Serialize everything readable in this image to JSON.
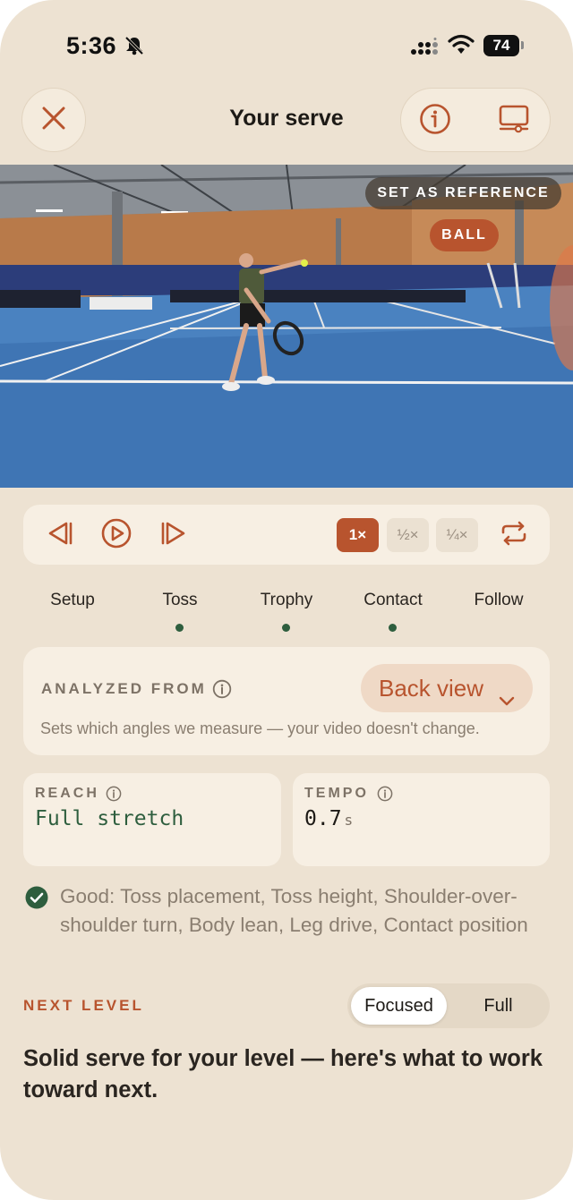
{
  "status_bar": {
    "time": "5:36",
    "battery": "74",
    "icons": [
      "bell-slash-icon",
      "signal-icon",
      "wifi-icon",
      "battery-icon"
    ]
  },
  "header": {
    "title": "Your serve",
    "close_icon": "close-icon",
    "info_icon": "info-icon",
    "device_icon": "device-icon"
  },
  "video": {
    "reference_button": "SET AS REFERENCE",
    "ball_badge": "BALL"
  },
  "playback": {
    "icons": [
      "step-back-icon",
      "play-icon",
      "step-forward-icon",
      "loop-icon"
    ],
    "speeds": [
      "1×",
      "½×",
      "¼×"
    ],
    "selected_speed": "1×"
  },
  "phases": [
    {
      "label": "Setup",
      "marked": false
    },
    {
      "label": "Toss",
      "marked": true
    },
    {
      "label": "Trophy",
      "marked": true
    },
    {
      "label": "Contact",
      "marked": true
    },
    {
      "label": "Follow",
      "marked": false
    }
  ],
  "analyzed": {
    "label": "ANALYZED FROM",
    "selected_view": "Back view",
    "description": "Sets which angles we measure — your video doesn't change."
  },
  "metrics": {
    "reach": {
      "label": "REACH",
      "value": "Full stretch"
    },
    "tempo": {
      "label": "TEMPO",
      "value": "0.7",
      "unit": "s"
    }
  },
  "good": {
    "text": "Good: Toss placement, Toss height, Shoulder-over-shoulder turn, Body lean, Leg drive, Contact position"
  },
  "next_level": {
    "label": "NEXT LEVEL",
    "options": [
      "Focused",
      "Full"
    ],
    "selected": "Focused",
    "summary": "Solid serve for your level — here's what to work toward next."
  },
  "colors": {
    "background": "#ede2d2",
    "card": "#f7efe3",
    "accent": "#b8542e",
    "success": "#2e5e3e"
  }
}
